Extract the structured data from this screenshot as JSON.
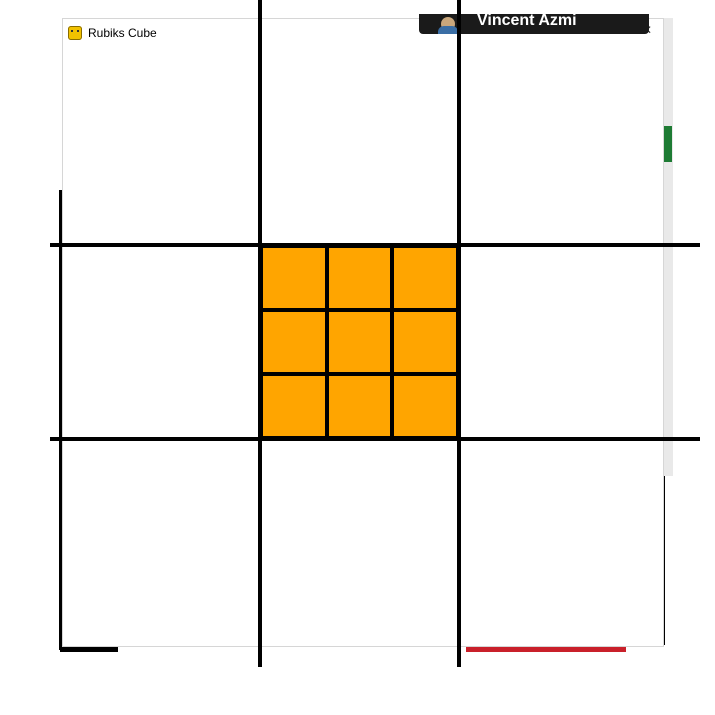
{
  "window": {
    "title": "Rubiks Cube",
    "controls": {
      "minimize": "—",
      "maximize": "☐",
      "close": "✕"
    }
  },
  "overlay": {
    "user_name": "Vincent Azmi"
  },
  "icons": {
    "app_icon": "pygame-snake-icon",
    "user_icon": "user-avatar-icon"
  },
  "cube": {
    "visible_face": "center",
    "face_colors": [
      [
        "#ffa500",
        "#ffa500",
        "#ffa500"
      ],
      [
        "#ffa500",
        "#ffa500",
        "#ffa500"
      ],
      [
        "#ffa500",
        "#ffa500",
        "#ffa500"
      ]
    ],
    "grid_color": "#000000",
    "outer_cells_color": "#ffffff"
  }
}
